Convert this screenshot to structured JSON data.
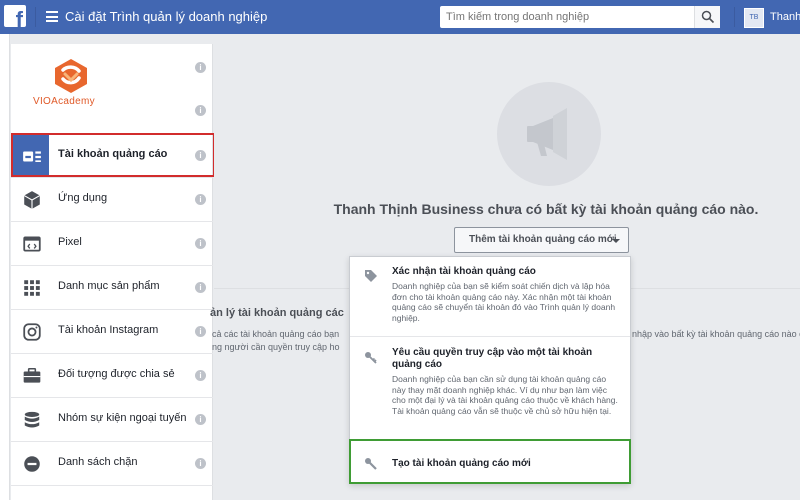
{
  "header": {
    "logo_letter": "f",
    "title": "Cài đặt Trình quản lý doanh nghiệp",
    "search_placeholder": "Tìm kiếm trong doanh nghiệp",
    "avatar_initials": "TB",
    "user_name": "Thanh"
  },
  "brand": {
    "logo_text": "VIOAcademy",
    "accent_color": "#e05a29"
  },
  "sidebar": {
    "items": [
      {
        "label": "Tài khoản quảng cáo",
        "icon": "ad-account-icon"
      },
      {
        "label": "Ứng dụng",
        "icon": "cube-icon"
      },
      {
        "label": "Pixel",
        "icon": "code-icon"
      },
      {
        "label": "Danh mục sản phẩm",
        "icon": "grid-icon"
      },
      {
        "label": "Tài khoản Instagram",
        "icon": "instagram-icon"
      },
      {
        "label": "Đối tượng được chia sẻ",
        "icon": "briefcase-icon"
      },
      {
        "label": "Nhóm sự kiện ngoại tuyến",
        "icon": "database-icon"
      },
      {
        "label": "Danh sách chặn",
        "icon": "block-icon"
      }
    ],
    "info_glyph": "i"
  },
  "main": {
    "empty_message": "Thanh Thịnh Business chưa có bất kỳ tài khoản quảng cáo nào.",
    "add_button": "Thêm tài khoản quảng cáo mới",
    "bg_heading": "ản lý tài khoản quảng các",
    "bg_line1_left": "cả các tài khoản quảng cáo bạn",
    "bg_line1_right": "nhập vào bất kỳ tài khoản quảng cáo nào c",
    "bg_line2_left": "ng người cần quyền truy cập ho"
  },
  "dropdown": {
    "items": [
      {
        "title": "Xác nhận tài khoản quảng cáo",
        "desc": "Doanh nghiệp của bạn sẽ kiểm soát chiến dịch và lập hóa đơn cho tài khoản quảng cáo này. Xác nhận một tài khoản quảng cáo sẽ chuyển tài khoản đó vào Trình quản lý doanh nghiệp.",
        "icon": "tag-icon"
      },
      {
        "title": "Yêu cầu quyền truy cập vào một tài khoản quảng cáo",
        "desc": "Doanh nghiệp của bạn cần sử dụng tài khoản quảng cáo này thay mặt doanh nghiệp khác. Ví dụ như bạn làm việc cho một đại lý và tài khoản quảng cáo thuộc về khách hàng. Tài khoản quảng cáo vẫn sẽ thuộc về chủ sở hữu hiện tại.",
        "icon": "key-icon"
      },
      {
        "title": "Tạo tài khoản quảng cáo mới",
        "desc": "",
        "icon": "wrench-icon"
      }
    ]
  },
  "colors": {
    "facebook_blue": "#4267b2",
    "highlight_red": "#d22c2c",
    "highlight_green": "#3f9c35"
  }
}
